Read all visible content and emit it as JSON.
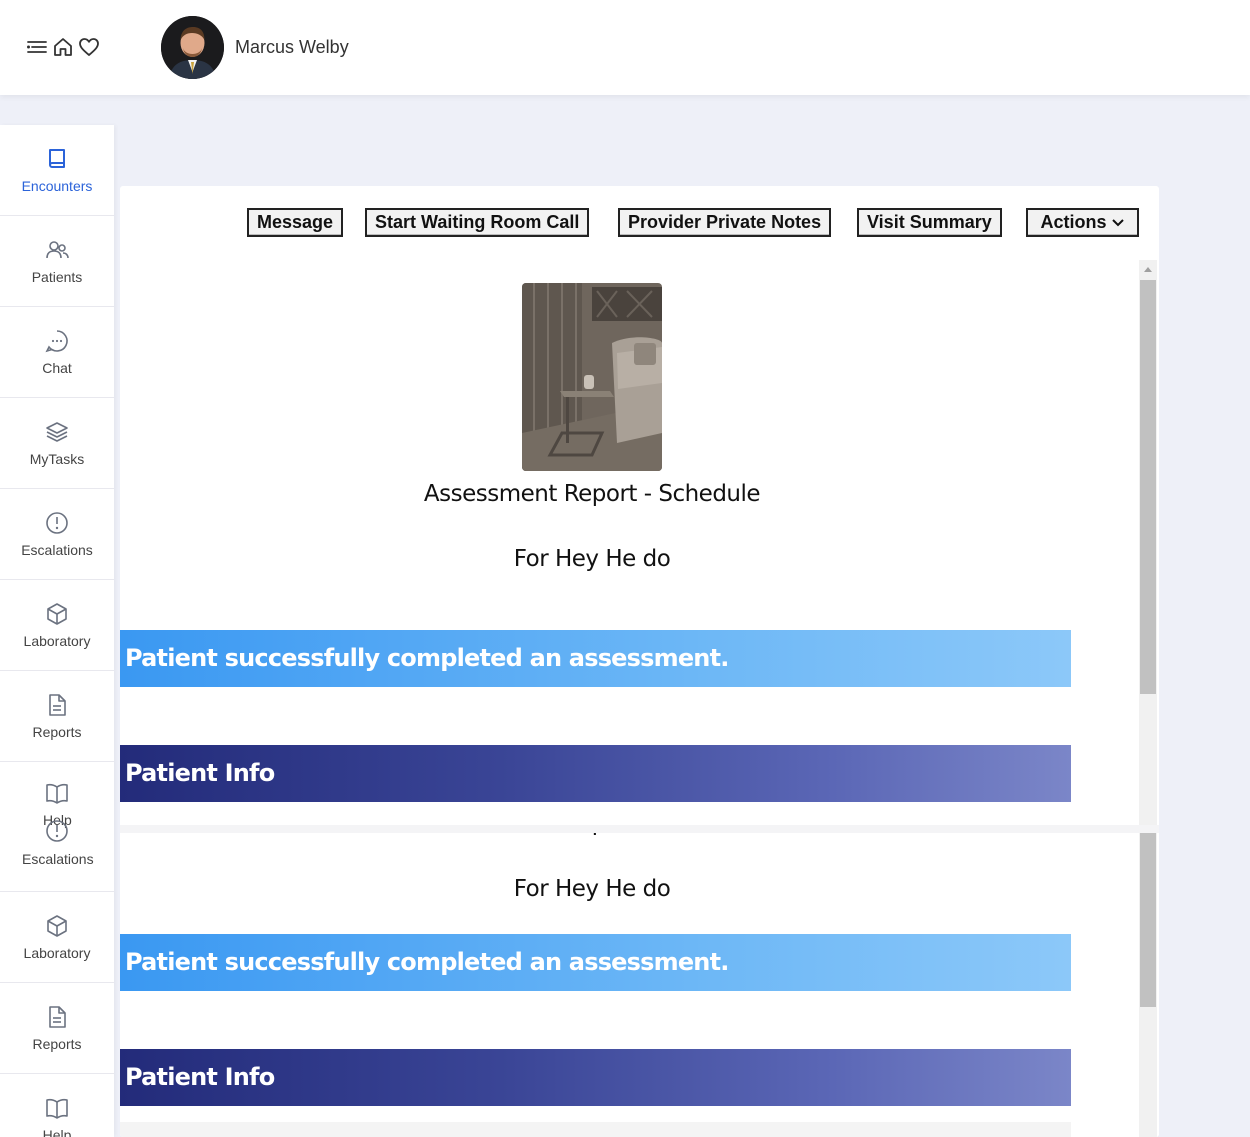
{
  "header": {
    "user_name": "Marcus Welby",
    "icons": [
      "menu-icon",
      "home-icon",
      "heart-icon"
    ]
  },
  "sidebar": {
    "items": [
      {
        "label": "Encounters",
        "icon": "book-icon",
        "active": true
      },
      {
        "label": "Patients",
        "icon": "users-icon"
      },
      {
        "label": "Chat",
        "icon": "chat-bubble-icon"
      },
      {
        "label": "MyTasks",
        "icon": "layers-icon"
      },
      {
        "label": "Escalations",
        "icon": "alert-circle-icon"
      },
      {
        "label": "Laboratory",
        "icon": "cube-icon"
      },
      {
        "label": "Reports",
        "icon": "document-icon"
      },
      {
        "label": "Help",
        "icon": "open-book-icon"
      },
      {
        "label": "Escalations",
        "icon": "alert-circle-icon"
      },
      {
        "label": "Laboratory",
        "icon": "cube-icon"
      },
      {
        "label": "Reports",
        "icon": "document-icon"
      },
      {
        "label": "Help",
        "icon": "open-book-icon"
      }
    ]
  },
  "toolbar": {
    "message": "Message",
    "start_call": "Start Waiting Room Call",
    "private_notes": "Provider Private Notes",
    "visit_summary": "Visit Summary",
    "actions": "Actions"
  },
  "report": {
    "title": "Assessment Report - Schedule",
    "subtitle": "For Hey He do",
    "status_banner": "Patient successfully completed an assessment.",
    "section_patient_info": "Patient Info"
  },
  "colors": {
    "accent": "#2b63d9",
    "banner_blue": "#3a98f2",
    "banner_navy": "#232b7a"
  }
}
